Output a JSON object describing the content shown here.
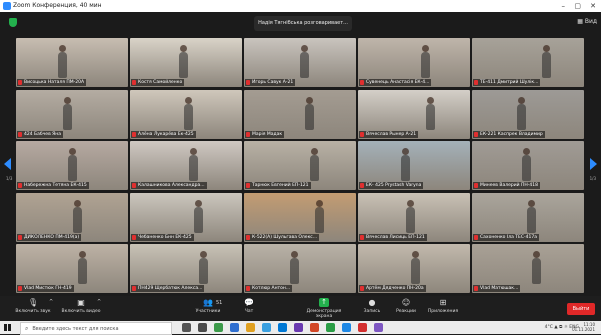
{
  "window": {
    "title": "Zoom Конференция, 40 мин",
    "minimize": "–",
    "maximize": "▢",
    "close": "✕"
  },
  "header": {
    "speaker": "Надія Тягнібська розговаривает...",
    "view_label": "▦ Вид"
  },
  "pagination": {
    "left": "1/3",
    "right": "1/3"
  },
  "participants": [
    {
      "name": "Висоцька Наталя ПМ-20А",
      "bg": "#c7bdb1"
    },
    {
      "name": "Костя Самойленко",
      "bg": "#d9d3c8"
    },
    {
      "name": "Игорь Савук А-21",
      "bg": "#c9c4be"
    },
    {
      "name": "Сувенець Анастасія ЕК-4...",
      "bg": "#bfb5aa"
    },
    {
      "name": "ТЕ-411 Дмитрий Шулік...",
      "bg": "#a7a299"
    },
    {
      "name": "424 Бабчев Яна",
      "bg": "#b4aca2"
    },
    {
      "name": "Алёна Лукарёва Ек-425",
      "bg": "#cfc7bb"
    },
    {
      "name": "Марія Мадак",
      "bg": "#a49c92"
    },
    {
      "name": "Вячеслав Рынер А-21",
      "bg": "#d4cfc8"
    },
    {
      "name": "ЕК-221 Каспрек Владимир",
      "bg": "#9d9a96"
    },
    {
      "name": "Набережна Тетяна ЕК-415",
      "bg": "#b6a9a1"
    },
    {
      "name": "Калашникова Александра...",
      "bg": "#cfc8c2"
    },
    {
      "name": "Тарнюк Евгений ЕП-121",
      "bg": "#b8b1a5"
    },
    {
      "name": "ЕК- 425 Prystash Varyna",
      "bg": "#a4b1b9"
    },
    {
      "name": "Минеев Валерий ПН-418",
      "bg": "#a09b95"
    },
    {
      "name": "ДИКОЛЕНКО ПМ-419(а)",
      "bg": "#b0a393"
    },
    {
      "name": "Чебаненко Бнн ЕК-425",
      "bg": "#cbc6bd"
    },
    {
      "name": "К-522(А) Шульгава Олекс...",
      "bg": "#c39c72"
    },
    {
      "name": "Вячеслав Лисиць ЕП-121",
      "bg": "#c9c1b5"
    },
    {
      "name": "Сахоненко Іла ТЕС-417а",
      "bg": "#aaa59c"
    },
    {
      "name": "Vlad Мистюк ГН-419",
      "bg": "#bdb2a5"
    },
    {
      "name": "ПН429 Щербатюк Алекса...",
      "bg": "#c8c2b6"
    },
    {
      "name": "Котлюр Антон...",
      "bg": "#b9b2a7"
    },
    {
      "name": "Артём Дядченко ПН-20а",
      "bg": "#c2b9ad"
    },
    {
      "name": "Vlad Матюшак...",
      "bg": "#a9a196"
    }
  ],
  "toolbar": {
    "audio": {
      "label": "Включить звук",
      "icon": "mic-muted-icon"
    },
    "video": {
      "label": "Включить видео",
      "icon": "video-off-icon"
    },
    "participants": {
      "label": "Участники",
      "count": "51",
      "icon": "participants-icon"
    },
    "chat": {
      "label": "Чат",
      "icon": "chat-icon"
    },
    "share": {
      "label": "Демонстрация экрана",
      "icon": "share-screen-icon"
    },
    "record": {
      "label": "Запись",
      "icon": "record-icon"
    },
    "reactions": {
      "label": "Реакции",
      "icon": "reactions-icon"
    },
    "apps": {
      "label": "Приложения",
      "icon": "apps-icon"
    },
    "end": {
      "label": "Выйти"
    }
  },
  "taskbar": {
    "search_placeholder": "Введите здесь текст для поиска",
    "tray": "4°C  ▲  ⧉  ☼  ENG",
    "time": "11:10",
    "date": "01.11.2021"
  }
}
